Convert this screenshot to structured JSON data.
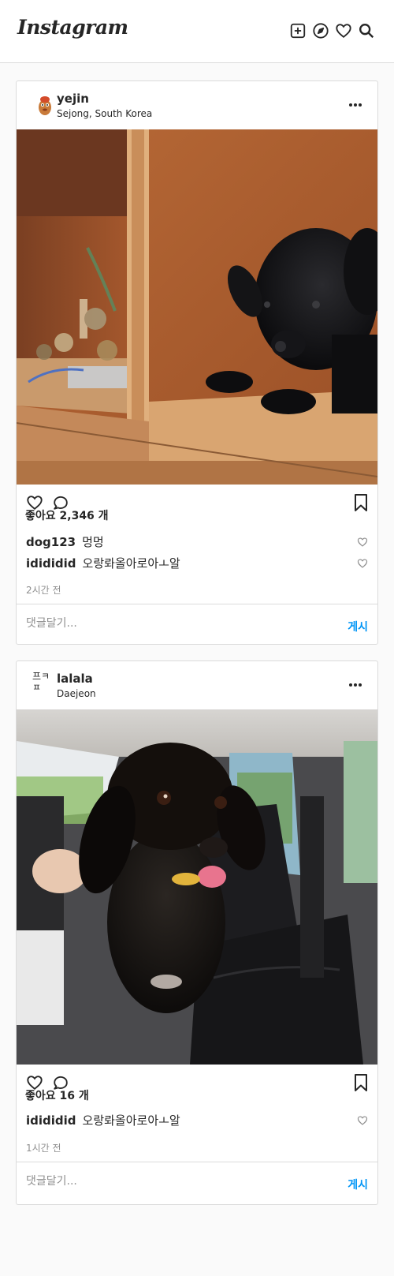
{
  "app": {
    "logo": "Instagram"
  },
  "header_icons": [
    "plus-square-icon",
    "compass-icon",
    "heart-icon",
    "search-icon"
  ],
  "posts": [
    {
      "user": "yejin",
      "location": "Sejong, South Korea",
      "likes": "좋아요 2,346 개",
      "comments": [
        {
          "user": "dog123",
          "text": "멍멍"
        },
        {
          "user": "idididid",
          "text": "오랑롸올아로아ㅗ알"
        }
      ],
      "time": "2시간 전",
      "comment_placeholder": "댓글달기...",
      "post_label": "게시"
    },
    {
      "user": "lalala",
      "avatar_alt": "프ㅋㅍ",
      "location": "Daejeon",
      "likes": "좋아요 16 개",
      "comments": [
        {
          "user": "idididid",
          "text": "오랑롸올아로아ㅗ알"
        }
      ],
      "time": "1시간 전",
      "comment_placeholder": "댓글달기...",
      "post_label": "게시"
    }
  ],
  "colors": {
    "accent": "#0095f6",
    "border": "#dbdbdb",
    "muted": "#8e8e8e"
  }
}
